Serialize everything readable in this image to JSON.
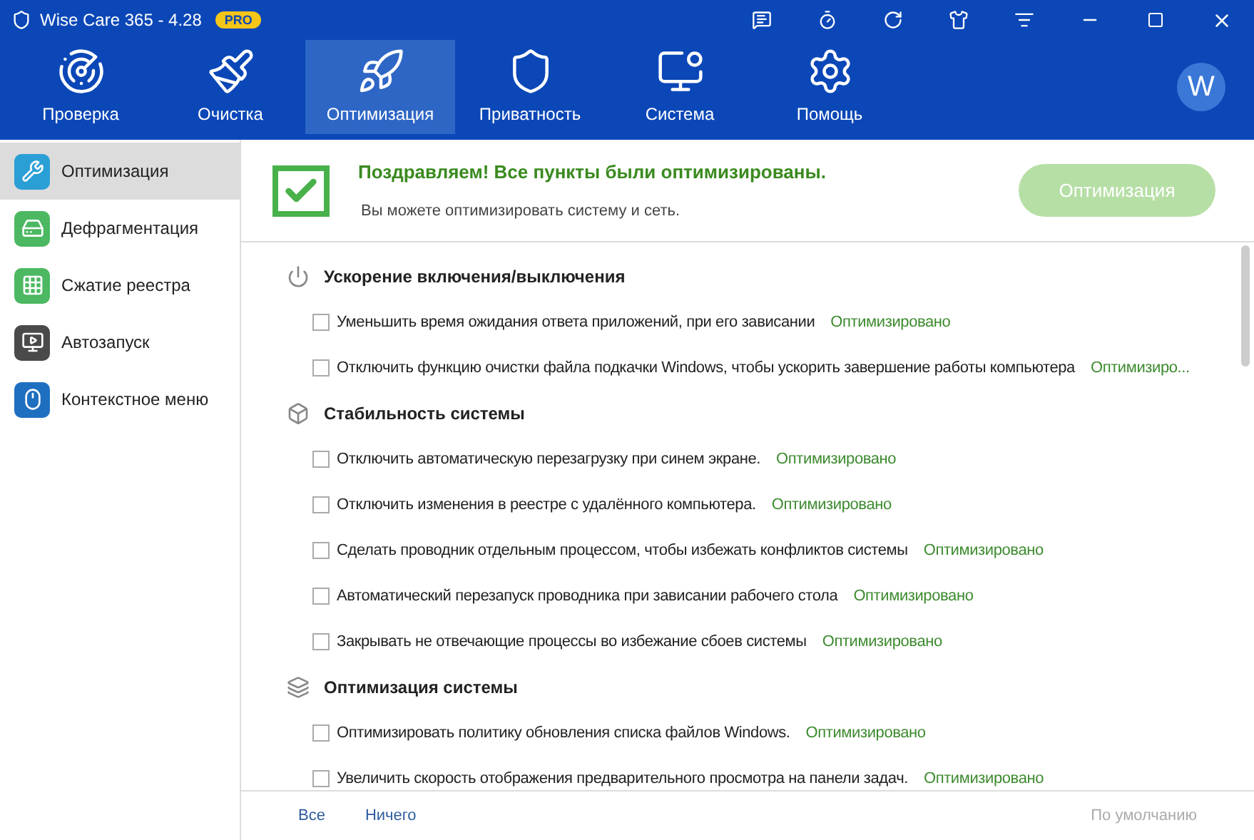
{
  "window": {
    "title": "Wise Care 365 - 4.28",
    "badge": "PRO"
  },
  "nav": [
    {
      "label": "Проверка",
      "selected": false
    },
    {
      "label": "Очистка",
      "selected": false
    },
    {
      "label": "Оптимизация",
      "selected": true
    },
    {
      "label": "Приватность",
      "selected": false
    },
    {
      "label": "Система",
      "selected": false
    },
    {
      "label": "Помощь",
      "selected": false
    }
  ],
  "avatar": "W",
  "sidebar": {
    "items": [
      {
        "label": "Оптимизация",
        "selected": true
      },
      {
        "label": "Дефрагментация",
        "selected": false
      },
      {
        "label": "Сжатие реестра",
        "selected": false
      },
      {
        "label": "Автозапуск",
        "selected": false
      },
      {
        "label": "Контекстное меню",
        "selected": false
      }
    ]
  },
  "header": {
    "title": "Поздравляем! Все пункты были оптимизированы.",
    "subtitle": "Вы можете оптимизировать систему и сеть.",
    "button": {
      "label": "Оптимизация",
      "disabled": true
    }
  },
  "sections": [
    {
      "title": "Ускорение включения/выключения",
      "items": [
        {
          "label": "Уменьшить время ожидания ответа приложений, при его зависании",
          "status": "Оптимизировано",
          "checked": false
        },
        {
          "label": "Отключить функцию очистки файла подкачки Windows, чтобы ускорить завершение работы компьютера",
          "status": "Оптимизиро...",
          "checked": false
        }
      ]
    },
    {
      "title": "Стабильность системы",
      "items": [
        {
          "label": "Отключить автоматическую перезагрузку при синем экране.",
          "status": "Оптимизировано",
          "checked": false
        },
        {
          "label": "Отключить изменения в реестре с удалённого компьютера.",
          "status": "Оптимизировано",
          "checked": false
        },
        {
          "label": "Сделать проводник отдельным процессом, чтобы избежать конфликтов системы",
          "status": "Оптимизировано",
          "checked": false
        },
        {
          "label": "Автоматический перезапуск проводника при зависании рабочего стола",
          "status": "Оптимизировано",
          "checked": false
        },
        {
          "label": "Закрывать не отвечающие процессы во избежание сбоев системы",
          "status": "Оптимизировано",
          "checked": false
        }
      ]
    },
    {
      "title": "Оптимизация системы",
      "items": [
        {
          "label": "Оптимизировать политику обновления списка файлов Windows.",
          "status": "Оптимизировано",
          "checked": false
        },
        {
          "label": "Увеличить скорость отображения предварительного просмотра на панели задач.",
          "status": "Оптимизировано",
          "checked": false
        }
      ]
    }
  ],
  "footer": {
    "links": [
      "Все",
      "Ничего"
    ],
    "default": "По умолчанию"
  }
}
